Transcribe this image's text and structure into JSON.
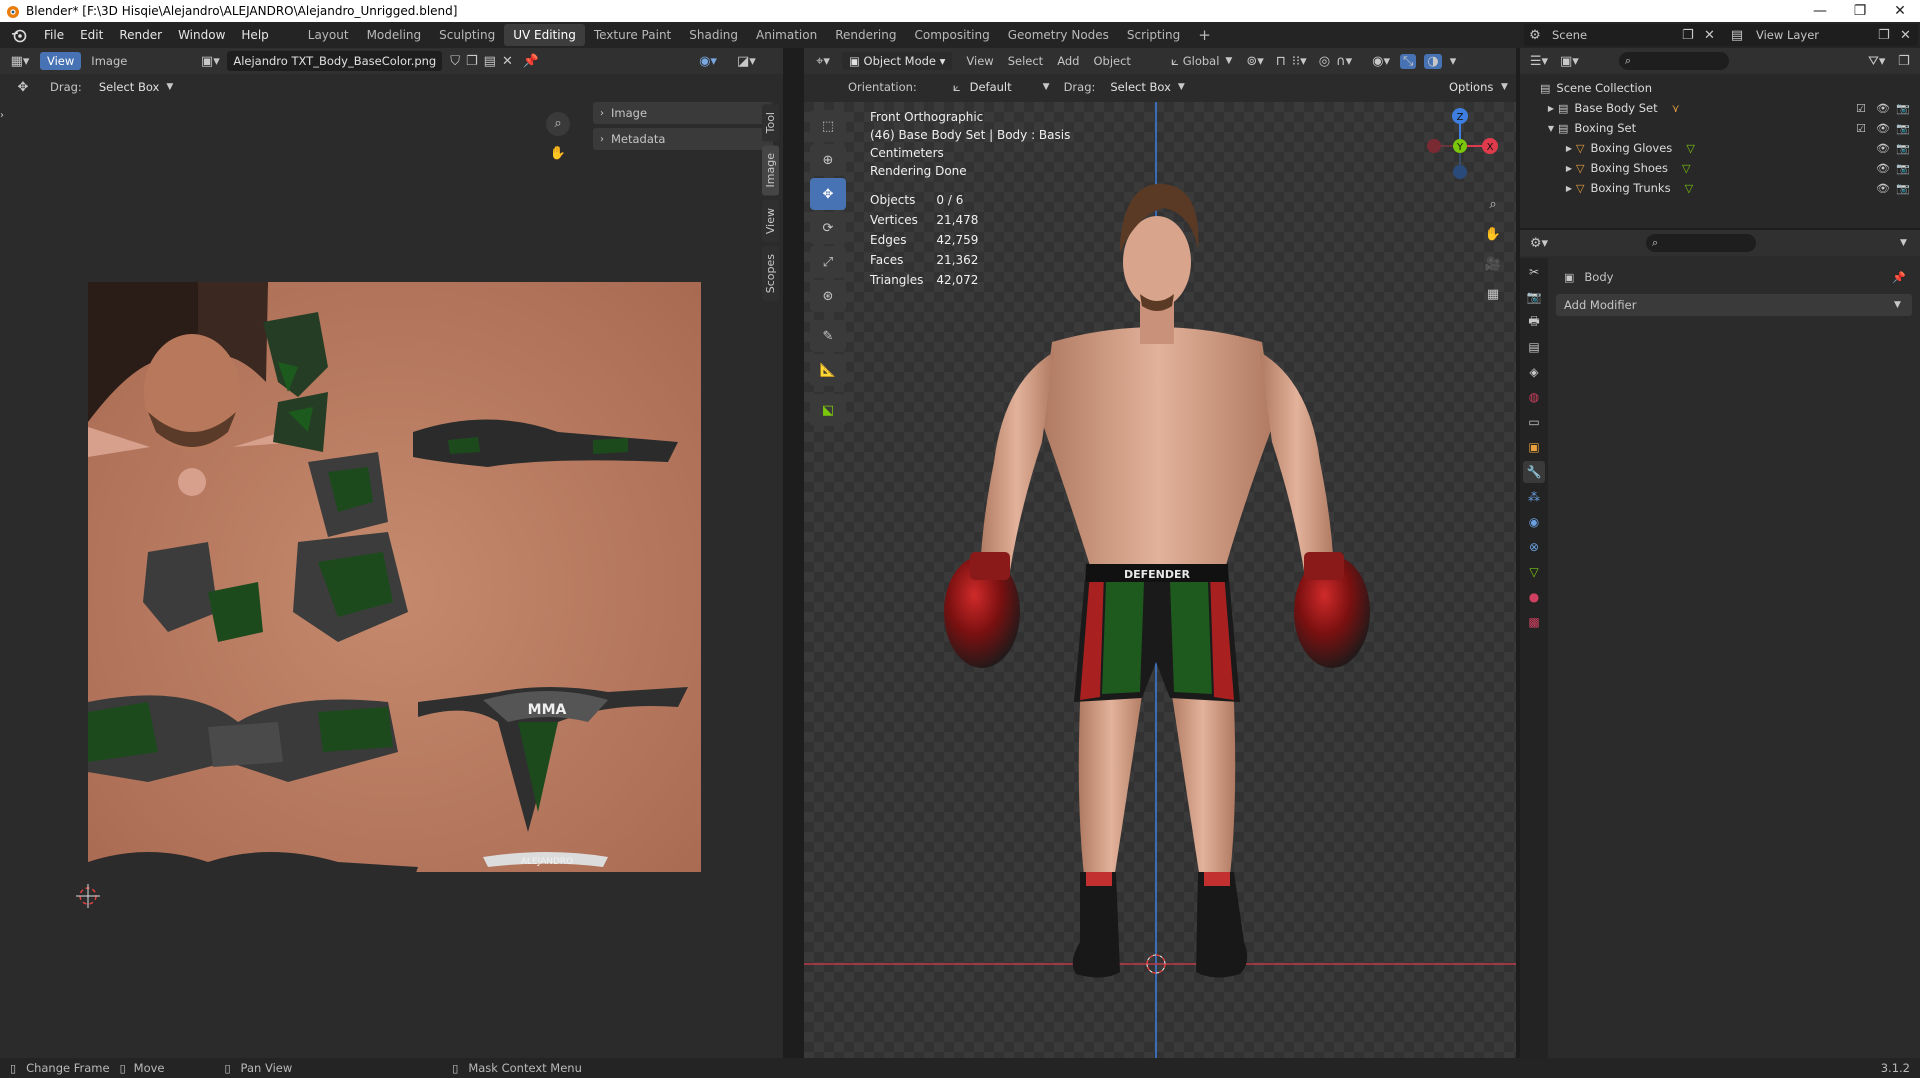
{
  "window": {
    "title": "Blender* [F:\\3D Hisqie\\Alejandro\\ALEJANDRO\\Alejandro_Unrigged.blend]",
    "minimize": "—",
    "maximize": "❐",
    "close": "✕"
  },
  "menus": [
    "File",
    "Edit",
    "Render",
    "Window",
    "Help"
  ],
  "workspaces": [
    "Layout",
    "Modeling",
    "Sculpting",
    "UV Editing",
    "Texture Paint",
    "Shading",
    "Animation",
    "Rendering",
    "Compositing",
    "Geometry Nodes",
    "Scripting"
  ],
  "active_workspace_index": 3,
  "scene": {
    "label": "Scene",
    "view_layer": "View Layer"
  },
  "uv_editor": {
    "view_btn": "View",
    "image_btn": "Image",
    "image_name": "Alejandro TXT_Body_BaseColor.png",
    "drag_label": "Drag:",
    "drag_value": "Select Box",
    "sidebar_sections": [
      "Image",
      "Metadata"
    ],
    "vtabs": [
      "Tool",
      "Image",
      "View",
      "Scopes"
    ],
    "texture_labels": {
      "mma": "MMA",
      "name": "ALEJANDRO"
    }
  },
  "viewport": {
    "mode": "Object Mode",
    "menus": [
      "View",
      "Select",
      "Add",
      "Object"
    ],
    "transform": "Global",
    "orientation_label": "Orientation:",
    "orientation_value": "Default",
    "drag_label": "Drag:",
    "drag_value": "Select Box",
    "options": "Options",
    "overlay_lines": [
      "Front Orthographic",
      "(46) Base Body Set | Body : Basis",
      "Centimeters",
      "Rendering Done"
    ],
    "stats": [
      {
        "label": "Objects",
        "value": "0 / 6"
      },
      {
        "label": "Vertices",
        "value": "21,478"
      },
      {
        "label": "Edges",
        "value": "42,759"
      },
      {
        "label": "Faces",
        "value": "21,362"
      },
      {
        "label": "Triangles",
        "value": "42,072"
      }
    ],
    "shorts_text": "DEFENDER",
    "gizmo": {
      "z": "Z",
      "y": "Y",
      "x": "X"
    }
  },
  "outliner": {
    "root": "Scene Collection",
    "items": [
      {
        "name": "Base Body Set",
        "level": 1,
        "type": "collection"
      },
      {
        "name": "Boxing Set",
        "level": 1,
        "type": "collection"
      },
      {
        "name": "Boxing Gloves",
        "level": 2,
        "type": "mesh"
      },
      {
        "name": "Boxing Shoes",
        "level": 2,
        "type": "mesh"
      },
      {
        "name": "Boxing Trunks",
        "level": 2,
        "type": "mesh"
      }
    ]
  },
  "properties": {
    "object_name": "Body",
    "add_modifier": "Add Modifier"
  },
  "statusbar": {
    "items": [
      "Change Frame",
      "Move",
      "Pan View",
      "Mask Context Menu"
    ],
    "version": "3.1.2"
  },
  "colors": {
    "accent": "#4772b3",
    "panel": "#2b2b2b",
    "header": "#303030",
    "x_axis": "#e03b4c",
    "y_axis": "#7ac70c",
    "z_axis": "#3d7ee0"
  }
}
